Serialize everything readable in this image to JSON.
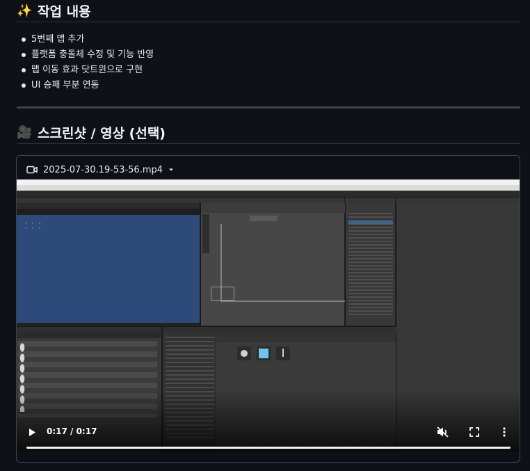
{
  "section_work": {
    "emoji": "✨",
    "title": "작업 내용",
    "items": [
      "5번째 맵 추가",
      "플랫폼 충돌체 수정 및 기능 반영",
      "맵 이동 효과 닷트윈으로 구현",
      "UI 승패 부분 연동"
    ]
  },
  "section_media": {
    "emoji": "🎥",
    "title": "스크린샷 / 영상 (선택)"
  },
  "video": {
    "filename": "2025-07-30.19-53-56.mp4",
    "time": "0:17 / 0:17",
    "progress_fraction": 1.0,
    "muted": true
  },
  "icons": {
    "video_file": "video-camera-icon",
    "dropdown": "caret-down-icon",
    "play": "play-icon",
    "mute": "muted-speaker-icon",
    "fullscreen": "fullscreen-icon",
    "more": "more-vertical-icon"
  },
  "colors": {
    "background": "#0e1117",
    "text": "#e6edf3",
    "border": "#3d444d",
    "unity_game_view": "#2d4a7a"
  }
}
